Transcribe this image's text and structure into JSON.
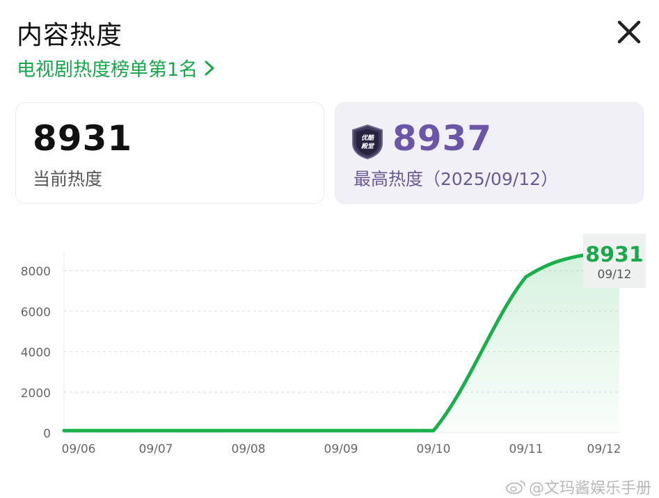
{
  "header": {
    "title": "内容热度",
    "rank_text": "电视剧热度榜单第1名"
  },
  "cards": {
    "current": {
      "value": "8931",
      "label": "当前热度"
    },
    "peak": {
      "value": "8937",
      "label": "最高热度（2025/09/12）",
      "badge_text": "优酷殿堂"
    }
  },
  "chart_data": {
    "type": "area",
    "x": [
      "09/06",
      "09/07",
      "09/08",
      "09/09",
      "09/10",
      "09/11",
      "09/12"
    ],
    "series": [
      {
        "values": [
          100,
          100,
          100,
          100,
          100,
          7700,
          8931
        ]
      }
    ],
    "yticks": [
      "0",
      "2000",
      "4000",
      "6000",
      "8000"
    ],
    "ylim": [
      0,
      9000
    ],
    "grid": true,
    "tooltip": {
      "value": "8931",
      "date": "09/12"
    },
    "colors": {
      "line": "#19b04a",
      "fill": "#19b04a"
    }
  },
  "watermark": "@文玛酱娱乐手册"
}
